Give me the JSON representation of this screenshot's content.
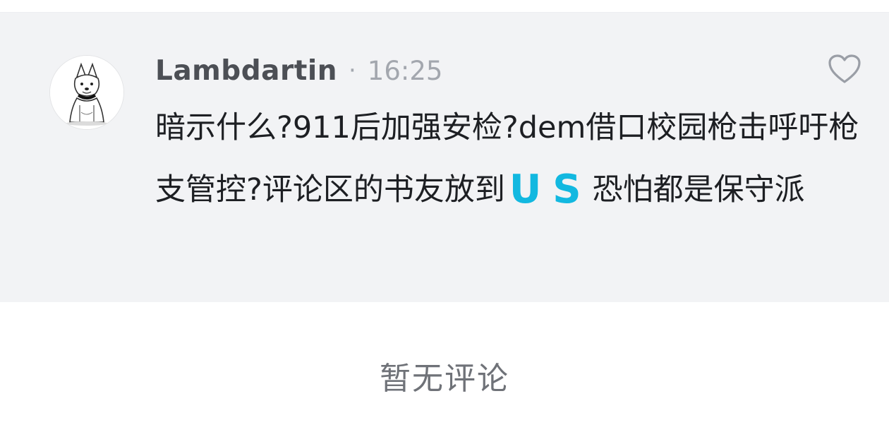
{
  "comment": {
    "username": "Lambdartin",
    "separator": "·",
    "time": "16:25",
    "text_part1": "暗示什么?911后加强安检?dem借口校园枪击呼吁枪支管控?评论区的书友放到",
    "emoji_text": "US",
    "text_part2": "恐怕都是保守派",
    "like_icon": "heart-outline-icon",
    "emoji_color": "#12b8e0"
  },
  "replies": {
    "empty_label": "暂无评论"
  }
}
